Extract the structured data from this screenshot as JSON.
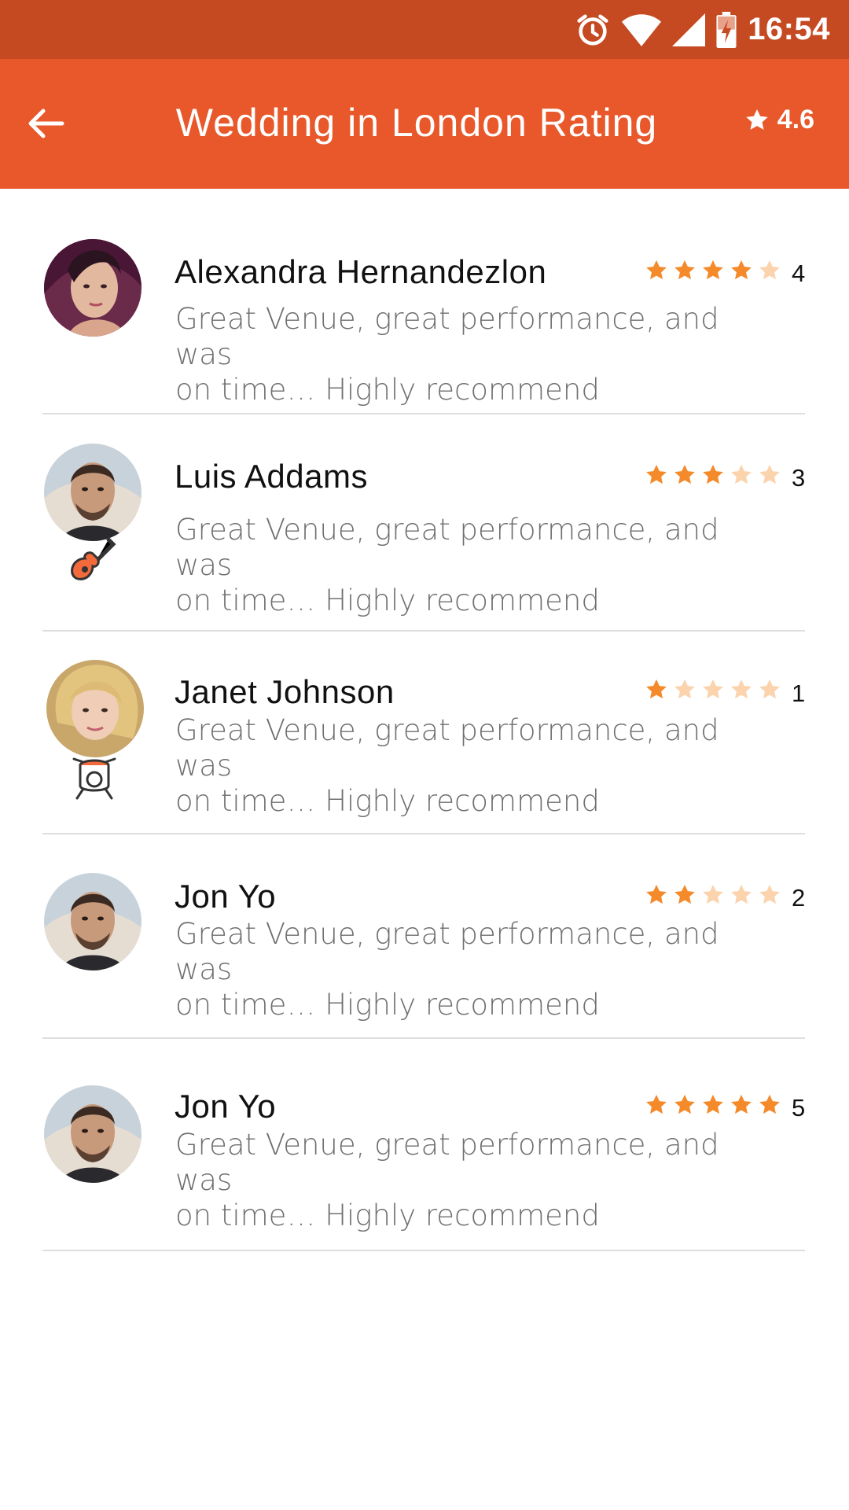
{
  "status_bar": {
    "time": "16:54",
    "icons": [
      "alarm-icon",
      "wifi-icon",
      "signal-icon",
      "battery-charging-icon"
    ]
  },
  "app_bar": {
    "title": "Wedding in London Rating",
    "rating": "4.6",
    "back_icon": "arrow-left-icon",
    "rating_icon": "star-icon"
  },
  "colors": {
    "status_bar": "#c54a22",
    "app_bar": "#e8582a",
    "star_filled": "#f58a2a",
    "star_empty": "#fbd3ad"
  },
  "reviews": [
    {
      "name": "Alexandra Hernandezlon",
      "text_line1": "Great Venue, great performance, and was",
      "text_line2": "on time… Highly recommend",
      "rating": 4,
      "score": "4",
      "badge": null
    },
    {
      "name": "Luis Addams",
      "text_line1": "Great Venue, great performance, and was",
      "text_line2": "on time… Highly recommend",
      "rating": 3,
      "score": "3",
      "badge": "guitar-icon"
    },
    {
      "name": "Janet Johnson",
      "text_line1": "Great Venue, great performance, and was",
      "text_line2": "on time… Highly recommend",
      "rating": 1,
      "score": "1",
      "badge": "drums-icon"
    },
    {
      "name": "Jon Yo",
      "text_line1": "Great Venue, great performance, and was",
      "text_line2": "on time… Highly recommend",
      "rating": 2,
      "score": "2",
      "badge": null
    },
    {
      "name": "Jon Yo",
      "text_line1": "Great Venue, great performance, and was",
      "text_line2": "on time… Highly recommend",
      "rating": 5,
      "score": "5",
      "badge": null
    }
  ]
}
